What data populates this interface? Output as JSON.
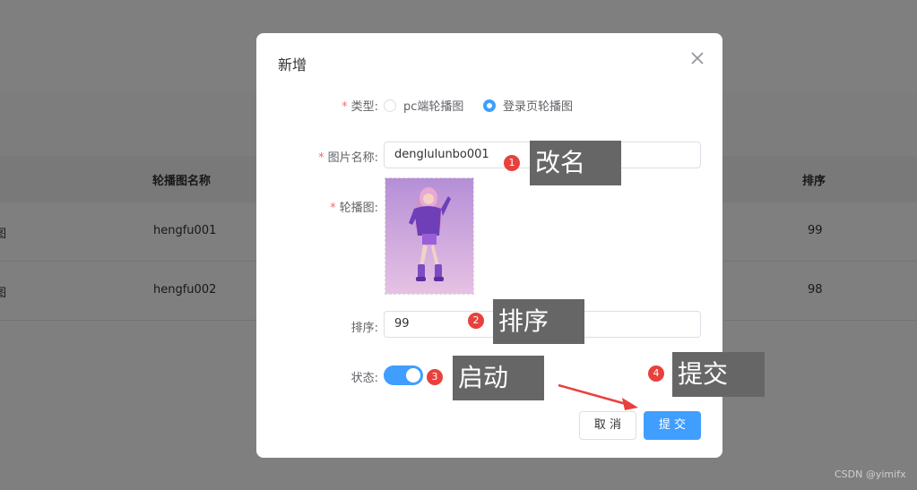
{
  "background_table": {
    "header": {
      "col_name": "轮播图名称",
      "col_sort": "排序"
    },
    "rows": [
      {
        "type_cut": "图",
        "name": "hengfu001",
        "sort": "99"
      },
      {
        "type_cut": "图",
        "name": "hengfu002",
        "sort": "98"
      }
    ]
  },
  "dialog": {
    "title": "新增",
    "fields": {
      "type": {
        "label": "类型:",
        "options": [
          {
            "label": "pc端轮播图",
            "checked": false
          },
          {
            "label": "登录页轮播图",
            "checked": true
          }
        ]
      },
      "name": {
        "label": "图片名称:",
        "value": "denglulunbo001"
      },
      "image": {
        "label": "轮播图:"
      },
      "sort": {
        "label": "排序:",
        "value": "99"
      },
      "status": {
        "label": "状态:",
        "on": true
      }
    },
    "buttons": {
      "cancel": "取 消",
      "submit": "提 交"
    }
  },
  "annotations": [
    {
      "num": "1",
      "text": "改名"
    },
    {
      "num": "2",
      "text": "排序"
    },
    {
      "num": "3",
      "text": "启动"
    },
    {
      "num": "4",
      "text": "提交"
    }
  ],
  "watermark": "CSDN @yimifx",
  "colors": {
    "primary": "#409eff",
    "required": "#f56c6c",
    "badge": "#e8413d",
    "annotation_bg": "#666666",
    "arrow": "#e8413d"
  }
}
